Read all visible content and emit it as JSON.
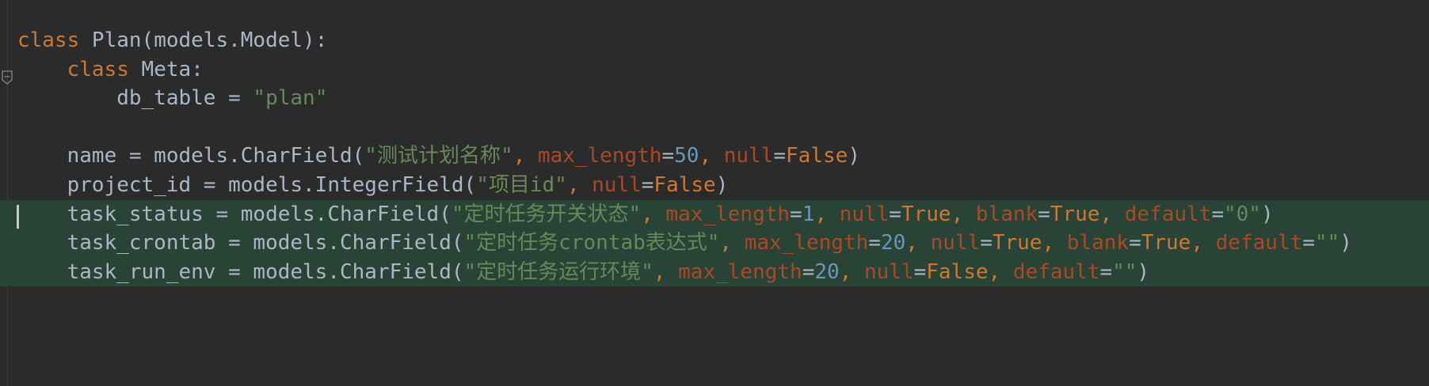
{
  "editor": {
    "lines": [
      {
        "tokens": [
          {
            "t": "class",
            "k": "kw"
          },
          {
            "t": " Plan(models.Model):",
            "k": "def"
          }
        ]
      },
      {
        "tokens": [
          {
            "t": "    ",
            "k": "def"
          },
          {
            "t": "class",
            "k": "kw"
          },
          {
            "t": " Meta:",
            "k": "def"
          }
        ]
      },
      {
        "tokens": [
          {
            "t": "        db_table = ",
            "k": "def"
          },
          {
            "t": "\"plan\"",
            "k": "str"
          }
        ]
      },
      {
        "tokens": []
      },
      {
        "tokens": [
          {
            "t": "    name = models.CharField(",
            "k": "def"
          },
          {
            "t": "\"测试计划名称\"",
            "k": "str"
          },
          {
            "t": ", ",
            "k": "pun"
          },
          {
            "t": "max_length",
            "k": "kwarg"
          },
          {
            "t": "=",
            "k": "def"
          },
          {
            "t": "50",
            "k": "num"
          },
          {
            "t": ", ",
            "k": "pun"
          },
          {
            "t": "null",
            "k": "kwarg"
          },
          {
            "t": "=",
            "k": "def"
          },
          {
            "t": "False",
            "k": "kw"
          },
          {
            "t": ")",
            "k": "def"
          }
        ]
      },
      {
        "tokens": [
          {
            "t": "    project_id = models.IntegerField(",
            "k": "def"
          },
          {
            "t": "\"项目id\"",
            "k": "str"
          },
          {
            "t": ", ",
            "k": "pun"
          },
          {
            "t": "null",
            "k": "kwarg"
          },
          {
            "t": "=",
            "k": "def"
          },
          {
            "t": "False",
            "k": "kw"
          },
          {
            "t": ")",
            "k": "def"
          }
        ]
      },
      {
        "changed": true,
        "caret": true,
        "tokens": [
          {
            "t": "    task_status = models.CharField(",
            "k": "def"
          },
          {
            "t": "\"定时任务开关状态\"",
            "k": "str"
          },
          {
            "t": ", ",
            "k": "pun"
          },
          {
            "t": "max_length",
            "k": "kwarg"
          },
          {
            "t": "=",
            "k": "def"
          },
          {
            "t": "1",
            "k": "num"
          },
          {
            "t": ", ",
            "k": "pun"
          },
          {
            "t": "null",
            "k": "kwarg"
          },
          {
            "t": "=",
            "k": "def"
          },
          {
            "t": "True",
            "k": "kw"
          },
          {
            "t": ", ",
            "k": "pun"
          },
          {
            "t": "blank",
            "k": "kwarg"
          },
          {
            "t": "=",
            "k": "def"
          },
          {
            "t": "True",
            "k": "kw"
          },
          {
            "t": ", ",
            "k": "pun"
          },
          {
            "t": "default",
            "k": "kwarg"
          },
          {
            "t": "=",
            "k": "def"
          },
          {
            "t": "\"0\"",
            "k": "str"
          },
          {
            "t": ")",
            "k": "def"
          }
        ]
      },
      {
        "changed": true,
        "tokens": [
          {
            "t": "    task_crontab = models.CharField(",
            "k": "def"
          },
          {
            "t": "\"定时任务crontab表达式\"",
            "k": "str"
          },
          {
            "t": ", ",
            "k": "pun"
          },
          {
            "t": "max_length",
            "k": "kwarg"
          },
          {
            "t": "=",
            "k": "def"
          },
          {
            "t": "20",
            "k": "num"
          },
          {
            "t": ", ",
            "k": "pun"
          },
          {
            "t": "null",
            "k": "kwarg"
          },
          {
            "t": "=",
            "k": "def"
          },
          {
            "t": "True",
            "k": "kw"
          },
          {
            "t": ", ",
            "k": "pun"
          },
          {
            "t": "blank",
            "k": "kwarg"
          },
          {
            "t": "=",
            "k": "def"
          },
          {
            "t": "True",
            "k": "kw"
          },
          {
            "t": ", ",
            "k": "pun"
          },
          {
            "t": "default",
            "k": "kwarg"
          },
          {
            "t": "=",
            "k": "def"
          },
          {
            "t": "\"\"",
            "k": "str"
          },
          {
            "t": ")",
            "k": "def"
          }
        ]
      },
      {
        "changed": true,
        "tokens": [
          {
            "t": "    task_run_env = models.CharField(",
            "k": "def"
          },
          {
            "t": "\"定时任务运行环境\"",
            "k": "str"
          },
          {
            "t": ", ",
            "k": "pun"
          },
          {
            "t": "max_length",
            "k": "kwarg"
          },
          {
            "t": "=",
            "k": "def"
          },
          {
            "t": "20",
            "k": "num"
          },
          {
            "t": ", ",
            "k": "pun"
          },
          {
            "t": "null",
            "k": "kwarg"
          },
          {
            "t": "=",
            "k": "def"
          },
          {
            "t": "False",
            "k": "kw"
          },
          {
            "t": ", ",
            "k": "pun"
          },
          {
            "t": "default",
            "k": "kwarg"
          },
          {
            "t": "=",
            "k": "def"
          },
          {
            "t": "\"\"",
            "k": "str"
          },
          {
            "t": ")",
            "k": "def"
          }
        ]
      }
    ],
    "icons": {
      "fold": "fold-marker-icon"
    },
    "colors": {
      "background": "#2b2b2b",
      "keyword": "#cc7832",
      "string": "#6a8759",
      "number": "#6897bb",
      "kwarg": "#aa4926",
      "default": "#a9b7c6",
      "changed_line": "#294436"
    }
  }
}
